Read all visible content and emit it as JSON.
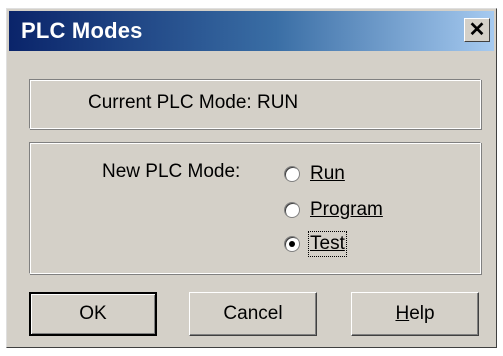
{
  "window": {
    "title": "PLC Modes",
    "close_symbol": "✕"
  },
  "current": {
    "label": "Current PLC Mode:",
    "value": "RUN"
  },
  "new_mode": {
    "label": "New PLC Mode:",
    "options": [
      {
        "label": "Run",
        "selected": false
      },
      {
        "label": "Program",
        "selected": false
      },
      {
        "label": "Test",
        "selected": true
      }
    ]
  },
  "buttons": {
    "ok": "OK",
    "cancel": "Cancel",
    "help_mnemonic": "H",
    "help_rest": "elp"
  },
  "colors": {
    "title_start": "#0a246a",
    "title_end": "#a6caf0",
    "face": "#d4d0c8"
  }
}
